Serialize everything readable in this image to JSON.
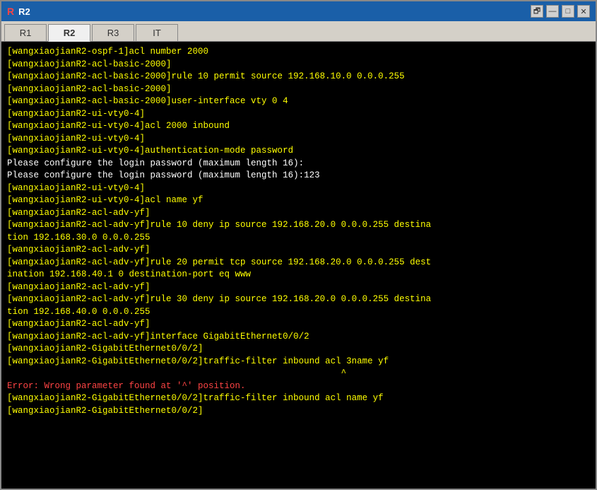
{
  "window": {
    "title": "R2",
    "icon": "R2"
  },
  "title_controls": {
    "restore": "🗗",
    "minimize": "—",
    "maximize": "□",
    "close": "✕"
  },
  "tabs": [
    {
      "label": "R1",
      "active": false
    },
    {
      "label": "R2",
      "active": true
    },
    {
      "label": "R3",
      "active": false
    },
    {
      "label": "IT",
      "active": false
    }
  ],
  "terminal_lines": [
    {
      "text": "[wangxiaojianR2-ospf-1]acl number 2000",
      "type": "normal"
    },
    {
      "text": "[wangxiaojianR2-acl-basic-2000]",
      "type": "normal"
    },
    {
      "text": "[wangxiaojianR2-acl-basic-2000]rule 10 permit source 192.168.10.0 0.0.0.255",
      "type": "normal"
    },
    {
      "text": "[wangxiaojianR2-acl-basic-2000]",
      "type": "normal"
    },
    {
      "text": "[wangxiaojianR2-acl-basic-2000]user-interface vty 0 4",
      "type": "normal"
    },
    {
      "text": "[wangxiaojianR2-ui-vty0-4]",
      "type": "normal"
    },
    {
      "text": "[wangxiaojianR2-ui-vty0-4]acl 2000 inbound",
      "type": "normal"
    },
    {
      "text": "[wangxiaojianR2-ui-vty0-4]",
      "type": "normal"
    },
    {
      "text": "[wangxiaojianR2-ui-vty0-4]authentication-mode password",
      "type": "normal"
    },
    {
      "text": "Please configure the login password (maximum length 16):",
      "type": "white"
    },
    {
      "text": "Please configure the login password (maximum length 16):123",
      "type": "white"
    },
    {
      "text": "[wangxiaojianR2-ui-vty0-4]",
      "type": "normal"
    },
    {
      "text": "[wangxiaojianR2-ui-vty0-4]acl name yf",
      "type": "normal"
    },
    {
      "text": "[wangxiaojianR2-acl-adv-yf]",
      "type": "normal"
    },
    {
      "text": "[wangxiaojianR2-acl-adv-yf]rule 10 deny ip source 192.168.20.0 0.0.0.255 destina",
      "type": "normal"
    },
    {
      "text": "tion 192.168.30.0 0.0.0.255",
      "type": "normal"
    },
    {
      "text": "[wangxiaojianR2-acl-adv-yf]",
      "type": "normal"
    },
    {
      "text": "[wangxiaojianR2-acl-adv-yf]rule 20 permit tcp source 192.168.20.0 0.0.0.255 dest",
      "type": "normal"
    },
    {
      "text": "ination 192.168.40.1 0 destination-port eq www",
      "type": "normal"
    },
    {
      "text": "[wangxiaojianR2-acl-adv-yf]",
      "type": "normal"
    },
    {
      "text": "[wangxiaojianR2-acl-adv-yf]rule 30 deny ip source 192.168.20.0 0.0.0.255 destina",
      "type": "normal"
    },
    {
      "text": "tion 192.168.40.0 0.0.0.255",
      "type": "normal"
    },
    {
      "text": "[wangxiaojianR2-acl-adv-yf]",
      "type": "normal"
    },
    {
      "text": "[wangxiaojianR2-acl-adv-yf]interface GigabitEthernet0/0/2",
      "type": "normal"
    },
    {
      "text": "[wangxiaojianR2-GigabitEthernet0/0/2]",
      "type": "normal"
    },
    {
      "text": "[wangxiaojianR2-GigabitEthernet0/0/2]traffic-filter inbound acl 3name yf",
      "type": "normal"
    },
    {
      "text": "                                                               ^",
      "type": "normal"
    },
    {
      "text": "",
      "type": "normal"
    },
    {
      "text": "Error: Wrong parameter found at '^' position.",
      "type": "error"
    },
    {
      "text": "[wangxiaojianR2-GigabitEthernet0/0/2]traffic-filter inbound acl name yf",
      "type": "normal"
    },
    {
      "text": "[wangxiaojianR2-GigabitEthernet0/0/2]",
      "type": "normal"
    }
  ]
}
